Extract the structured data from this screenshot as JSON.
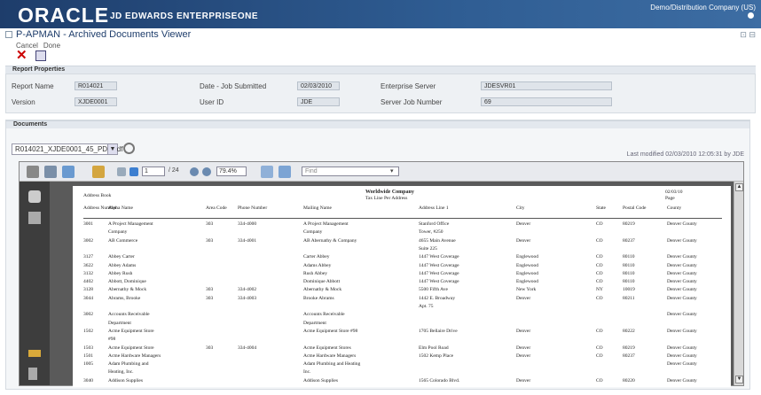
{
  "banner": {
    "logo": "ORACLE",
    "product": "JD EDWARDS ENTERPRISEONE",
    "env": "Demo/Distribution Company (US)"
  },
  "window": {
    "title": "P-APMAN - Archived Documents Viewer"
  },
  "actions": {
    "cancel_label": "Cancel",
    "done_label": "Done"
  },
  "report_section": {
    "title": "Report Properties"
  },
  "props": {
    "report_name_label": "Report Name",
    "report_name": "R014021",
    "version_label": "Version",
    "version": "XJDE0001",
    "date_label": "Date - Job Submitted",
    "date": "02/03/2010",
    "user_label": "User ID",
    "user": "JDE",
    "server_label": "Enterprise Server",
    "server": "JDESVR01",
    "job_label": "Server Job Number",
    "job": "69"
  },
  "docs_section": {
    "title": "Documents"
  },
  "document": {
    "selected": "R014021_XJDE0001_45_PDF.pdf",
    "last_modified": "Last modified 02/03/2010 12:05:31 by JDE"
  },
  "viewer": {
    "page": "1",
    "of": "/ 24",
    "zoom": "79.4%",
    "find": "Find"
  },
  "report": {
    "left_hdr": "Address Book",
    "center_title": "Worldwide Company",
    "center_sub": "Tax Line Per Address",
    "right_date": "02/03/10",
    "right_page": "Page",
    "cols": [
      "Address Number",
      "Alpha Name",
      "Area Code",
      "Phone Number",
      "Mailing Name",
      "Address Line 1",
      "City",
      "State",
      "Postal Code",
      "County"
    ],
    "rows": [
      [
        "3001",
        "A Project Management",
        "303",
        "334-4000",
        "A Project Management",
        "Stanford Office",
        "Denver",
        "CO",
        "80219",
        "Denver County"
      ],
      [
        "",
        "Company",
        "",
        "",
        "Company",
        "Tower, #250",
        "",
        "",
        "",
        ""
      ],
      [
        "3002",
        "AB Commerce",
        "303",
        "334-4001",
        "AB Abernathy & Company",
        "4655 Main Avenue",
        "Denver",
        "CO",
        "80237",
        "Denver County"
      ],
      [
        "",
        "",
        "",
        "",
        "",
        "Suite 225",
        "",
        "",
        "",
        ""
      ],
      [
        "3127",
        "Abbey Carter",
        "",
        "",
        "Carter Abbey",
        "1447 West Coverage",
        "Englewood",
        "CO",
        "80110",
        "Denver County"
      ],
      [
        "3622",
        "Abbey Adams",
        "",
        "",
        "Adams Abbey",
        "1447 West Coverage",
        "Englewood",
        "CO",
        "80110",
        "Denver County"
      ],
      [
        "3132",
        "Abbey Rush",
        "",
        "",
        "Rush Abbey",
        "1447 West Coverage",
        "Englewood",
        "CO",
        "80110",
        "Denver County"
      ],
      [
        "4402",
        "Abbott, Dominique",
        "",
        "",
        "Dominique Abbott",
        "1447 West Coverage",
        "Englewood",
        "CO",
        "80110",
        "Denver County"
      ],
      [
        "3128",
        "Abernathy & Mock",
        "303",
        "334-4002",
        "Abernathy & Mock",
        "5500 Fifth Ave",
        "New York",
        "NY",
        "10019",
        "Denver County"
      ],
      [
        "3044",
        "Abrams, Brooke",
        "303",
        "334-4003",
        "Brooke Abrams",
        "1442 E. Broadway",
        "Denver",
        "CO",
        "80211",
        "Denver County"
      ],
      [
        "",
        "",
        "",
        "",
        "",
        "Apt. 75",
        "",
        "",
        "",
        ""
      ],
      [
        "3002",
        "Accounts Receivable",
        "",
        "",
        "Accounts Receivable",
        "",
        "",
        "",
        "",
        "Denver County"
      ],
      [
        "",
        "Department",
        "",
        "",
        "Department",
        "",
        "",
        "",
        "",
        ""
      ],
      [
        "1502",
        "Acme Equipment Store",
        "",
        "",
        "Acme Equipment Store #98",
        "1705 Bellaire Drive",
        "Denver",
        "CO",
        "80222",
        "Denver County"
      ],
      [
        "",
        "#98",
        "",
        "",
        "",
        "",
        "",
        "",
        "",
        ""
      ],
      [
        "1503",
        "Acme Equipment Store",
        "303",
        "334-4004",
        "Acme Equipment Stores",
        "Elm Pool Road",
        "Denver",
        "CO",
        "80219",
        "Denver County"
      ],
      [
        "1501",
        "Acme Hardware Managers",
        "",
        "",
        "Acme Hardware Managers",
        "1502 Kemp Place",
        "Denver",
        "CO",
        "80237",
        "Denver County"
      ],
      [
        "1005",
        "Adam Plumbing and",
        "",
        "",
        "Adam Plumbing and Heating",
        "",
        "",
        "",
        "",
        "Denver County"
      ],
      [
        "",
        "Heating, Inc.",
        "",
        "",
        "Inc.",
        "",
        "",
        "",
        "",
        ""
      ],
      [
        "3040",
        "Addison Supplies",
        "",
        "",
        "Addison Supplies",
        "1565 Colorado Blvd.",
        "Denver",
        "CO",
        "80220",
        "Denver County"
      ]
    ]
  }
}
